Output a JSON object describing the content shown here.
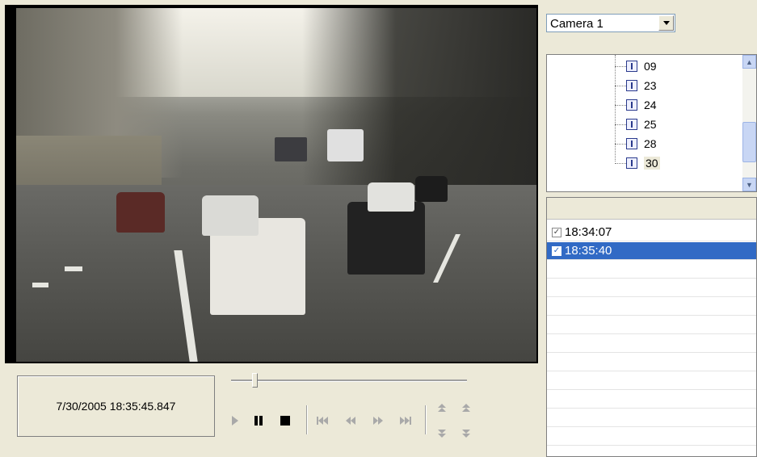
{
  "player": {
    "timestamp": "7/30/2005 18:35:45.847",
    "seek_position_fraction": 0.09
  },
  "controls": {
    "play_icon": "play-icon",
    "pause_icon": "pause-icon",
    "stop_icon": "stop-icon",
    "first_icon": "skip-to-start-icon",
    "rewind_icon": "rewind-icon",
    "forward_icon": "fast-forward-icon",
    "last_icon": "skip-to-end-icon",
    "speed_up_icon": "speed-up-icon",
    "step_up_icon": "step-up-icon",
    "speed_down_icon": "speed-down-icon",
    "step_down_icon": "step-down-icon"
  },
  "camera_select": {
    "selected": "Camera 1"
  },
  "tree": {
    "items": [
      {
        "label": "09",
        "selected": false
      },
      {
        "label": "23",
        "selected": false
      },
      {
        "label": "24",
        "selected": false
      },
      {
        "label": "25",
        "selected": false
      },
      {
        "label": "28",
        "selected": false
      },
      {
        "label": "30",
        "selected": true
      }
    ]
  },
  "clip_list": {
    "rows": [
      {
        "time": "18:34:07",
        "checked": true,
        "selected": false
      },
      {
        "time": "18:35:40",
        "checked": true,
        "selected": true
      }
    ]
  },
  "colors": {
    "selection": "#316ac5",
    "background": "#ece9d8"
  }
}
